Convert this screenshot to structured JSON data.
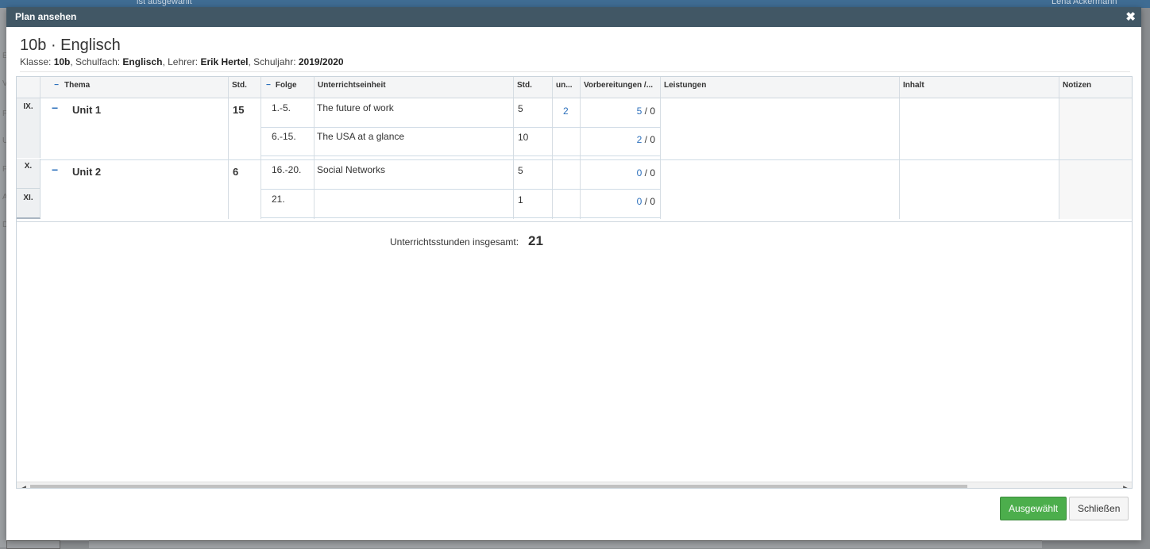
{
  "background": {
    "top_left_text": "ist ausgewählt",
    "top_right_text": "Lena Ackermann",
    "left_letters": [
      "E",
      "V",
      "F",
      "U",
      "F",
      "A",
      "D"
    ]
  },
  "modal": {
    "title": "Plan ansehen",
    "close_icon": "close-icon"
  },
  "plan": {
    "title_class": "10b",
    "title_separator": "·",
    "title_subject": "Englisch",
    "meta": {
      "klasse_label": "Klasse: ",
      "klasse": "10b",
      "schulfach_label": ", Schulfach: ",
      "schulfach": "Englisch",
      "lehrer_label": ", Lehrer: ",
      "lehrer": "Erik Hertel",
      "schuljahr_label": ", Schuljahr: ",
      "schuljahr": "2019/2020"
    }
  },
  "table": {
    "headers": {
      "thema": "Thema",
      "std": "Std.",
      "folge": "Folge",
      "unterrichtseinheit": "Unterrichtseinheit",
      "std2": "Std.",
      "un": "un...",
      "vorbereitungen": "Vorbereitungen /...",
      "leistungen": "Leistungen",
      "inhalt": "Inhalt",
      "notizen": "Notizen"
    },
    "months": [
      "IX.",
      "X.",
      "XI."
    ],
    "topics": [
      {
        "name": "Unit 1",
        "std": "15"
      },
      {
        "name": "Unit 2",
        "std": "6"
      }
    ],
    "lessons": [
      {
        "folge": "1.-5.",
        "einheit": "The future of work",
        "std": "5",
        "un": "2",
        "vorb_a": "5",
        "vorb_b": "0"
      },
      {
        "folge": "6.-15.",
        "einheit": "The USA at a glance",
        "std": "10",
        "un": "",
        "vorb_a": "2",
        "vorb_b": "0"
      },
      {
        "folge": "16.-20.",
        "einheit": "Social Networks",
        "std": "5",
        "un": "",
        "vorb_a": "0",
        "vorb_b": "0"
      },
      {
        "folge": "21.",
        "einheit": "",
        "std": "1",
        "un": "",
        "vorb_a": "0",
        "vorb_b": "0"
      }
    ],
    "vorb_separator": " / ",
    "total_label": "Unterrichtsstunden insgesamt:",
    "total_value": "21"
  },
  "buttons": {
    "select": "Ausgewählt",
    "close": "Schließen"
  },
  "colors": {
    "header_bar": "#415765",
    "link_blue": "#2a6ebb",
    "primary_green": "#4cae4c"
  }
}
